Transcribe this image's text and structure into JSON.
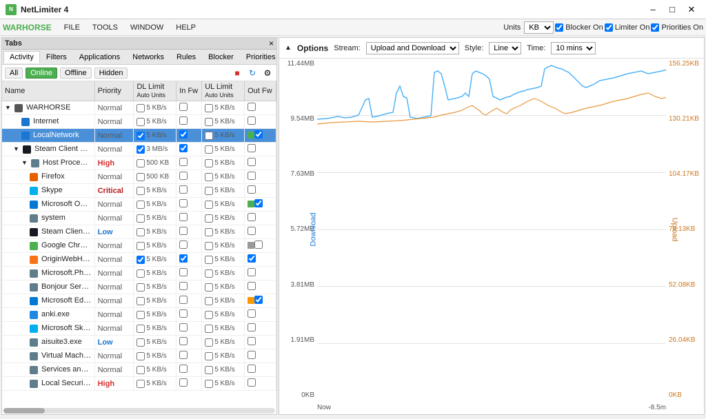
{
  "titleBar": {
    "title": "NetLimiter 4",
    "controls": [
      "minimize",
      "maximize",
      "close"
    ]
  },
  "menuBar": {
    "appName": "WARHORSE",
    "items": [
      "FILE",
      "TOOLS",
      "WINDOW",
      "HELP"
    ],
    "units_label": "Units",
    "units_value": "KB",
    "blocker_on": "Blocker On",
    "limiter_on": "Limiter On",
    "priorities_on": "Priorities On"
  },
  "tabsPanel": {
    "label": "Tabs",
    "close": "×"
  },
  "leftPanel": {
    "tabs": [
      {
        "label": "Activity",
        "active": true
      },
      {
        "label": "Filters",
        "active": false
      },
      {
        "label": "Applications",
        "active": false
      },
      {
        "label": "Networks",
        "active": false
      },
      {
        "label": "Rules",
        "active": false
      },
      {
        "label": "Blocker",
        "active": false
      },
      {
        "label": "Priorities",
        "active": false
      }
    ],
    "filters": [
      {
        "label": "All",
        "active": false
      },
      {
        "label": "Online",
        "active": true
      },
      {
        "label": "Offline",
        "active": false
      },
      {
        "label": "Hidden",
        "active": false
      }
    ],
    "columns": {
      "name": "Name",
      "priority": "Priority",
      "dl_limit": "DL Limit",
      "dl_limit_sub": "Auto Units",
      "in_fw": "In Fw",
      "ul_limit": "UL Limit",
      "ul_limit_sub": "Auto Units",
      "out_fw": "Out Fw"
    },
    "rows": [
      {
        "level": 0,
        "expand": true,
        "icon": "pc",
        "name": "WARHORSE",
        "priority": "Normal",
        "dl_limit": "5 KB/s",
        "in_fw": false,
        "ul_limit": "5 KB/s",
        "out_fw": false,
        "indicator": "none"
      },
      {
        "level": 1,
        "expand": false,
        "icon": "net",
        "name": "Internet",
        "priority": "Normal",
        "dl_limit": "5 KB/s",
        "in_fw": false,
        "ul_limit": "5 KB/s",
        "out_fw": false,
        "indicator": "none"
      },
      {
        "level": 1,
        "expand": false,
        "icon": "net",
        "name": "LocalNetwork",
        "priority": "Normal",
        "dl_limit": "5 KB/s",
        "in_fw": true,
        "ul_limit": "5 KB/s",
        "out_fw": true,
        "indicator": "green",
        "selected": true
      },
      {
        "level": 1,
        "expand": true,
        "icon": "steam",
        "name": "Steam Client Bootstra",
        "priority": "Normal",
        "dl_limit": "3 MB/s",
        "in_fw": true,
        "ul_limit": "5 KB/s",
        "out_fw": false,
        "indicator": "none"
      },
      {
        "level": 2,
        "expand": true,
        "icon": "proc",
        "name": "Host Process for Winc",
        "priority": "High",
        "dl_limit": "500 KB",
        "in_fw": false,
        "ul_limit": "5 KB/s",
        "out_fw": false,
        "indicator": "none"
      },
      {
        "level": 2,
        "expand": false,
        "icon": "firefox",
        "name": "Firefox",
        "priority": "Normal",
        "dl_limit": "500 KB",
        "in_fw": false,
        "ul_limit": "5 KB/s",
        "out_fw": false,
        "indicator": "none"
      },
      {
        "level": 2,
        "expand": false,
        "icon": "skype",
        "name": "Skype",
        "priority": "Critical",
        "dl_limit": "5 KB/s",
        "in_fw": false,
        "ul_limit": "5 KB/s",
        "out_fw": false,
        "indicator": "none"
      },
      {
        "level": 2,
        "expand": false,
        "icon": "onedrive",
        "name": "Microsoft OneDrive",
        "priority": "Normal",
        "dl_limit": "5 KB/s",
        "in_fw": false,
        "ul_limit": "5 KB/s",
        "out_fw": true,
        "indicator": "green"
      },
      {
        "level": 2,
        "expand": false,
        "icon": "proc",
        "name": "system",
        "priority": "Normal",
        "dl_limit": "5 KB/s",
        "in_fw": false,
        "ul_limit": "5 KB/s",
        "out_fw": false,
        "indicator": "none"
      },
      {
        "level": 2,
        "expand": false,
        "icon": "steam",
        "name": "Steam Client WebHel",
        "priority": "Low",
        "dl_limit": "5 KB/s",
        "in_fw": false,
        "ul_limit": "5 KB/s",
        "out_fw": false,
        "indicator": "none"
      },
      {
        "level": 2,
        "expand": false,
        "icon": "chrome",
        "name": "Google Chrome",
        "priority": "Normal",
        "dl_limit": "5 KB/s",
        "in_fw": false,
        "ul_limit": "5 KB/s",
        "out_fw": false,
        "indicator": "grey"
      },
      {
        "level": 2,
        "expand": false,
        "icon": "origin",
        "name": "OriginWebHelperServ",
        "priority": "Normal",
        "dl_limit": "5 KB/s",
        "in_fw": true,
        "ul_limit": "5 KB/s",
        "out_fw": true,
        "indicator": "none"
      },
      {
        "level": 2,
        "expand": false,
        "icon": "proc",
        "name": "Microsoft.Photos.exe",
        "priority": "Normal",
        "dl_limit": "5 KB/s",
        "in_fw": false,
        "ul_limit": "5 KB/s",
        "out_fw": false,
        "indicator": "none"
      },
      {
        "level": 2,
        "expand": false,
        "icon": "proc",
        "name": "Bonjour Service",
        "priority": "Normal",
        "dl_limit": "5 KB/s",
        "in_fw": false,
        "ul_limit": "5 KB/s",
        "out_fw": false,
        "indicator": "none"
      },
      {
        "level": 2,
        "expand": false,
        "icon": "edge",
        "name": "Microsoft Edge",
        "priority": "Normal",
        "dl_limit": "5 KB/s",
        "in_fw": false,
        "ul_limit": "5 KB/s",
        "out_fw": true,
        "indicator": "orange"
      },
      {
        "level": 2,
        "expand": false,
        "icon": "anki",
        "name": "anki.exe",
        "priority": "Normal",
        "dl_limit": "5 KB/s",
        "in_fw": false,
        "ul_limit": "5 KB/s",
        "out_fw": false,
        "indicator": "none"
      },
      {
        "level": 2,
        "expand": false,
        "icon": "skype",
        "name": "Microsoft Skype",
        "priority": "Normal",
        "dl_limit": "5 KB/s",
        "in_fw": false,
        "ul_limit": "5 KB/s",
        "out_fw": false,
        "indicator": "none"
      },
      {
        "level": 2,
        "expand": false,
        "icon": "proc",
        "name": "aisuite3.exe",
        "priority": "Low",
        "dl_limit": "5 KB/s",
        "in_fw": false,
        "ul_limit": "5 KB/s",
        "out_fw": false,
        "indicator": "none"
      },
      {
        "level": 2,
        "expand": false,
        "icon": "proc",
        "name": "Virtual Machine Mana",
        "priority": "Normal",
        "dl_limit": "5 KB/s",
        "in_fw": false,
        "ul_limit": "5 KB/s",
        "out_fw": false,
        "indicator": "none"
      },
      {
        "level": 2,
        "expand": false,
        "icon": "proc",
        "name": "Services and Controlle",
        "priority": "Normal",
        "dl_limit": "5 KB/s",
        "in_fw": false,
        "ul_limit": "5 KB/s",
        "out_fw": false,
        "indicator": "none"
      },
      {
        "level": 2,
        "expand": false,
        "icon": "proc",
        "name": "Local Security Autho",
        "priority": "High",
        "dl_limit": "5 KB/s",
        "in_fw": false,
        "ul_limit": "5 KB/s",
        "out_fw": false,
        "indicator": "none"
      }
    ]
  },
  "rightPanel": {
    "options_label": "Options",
    "stream_label": "Stream:",
    "stream_value": "Upload and Download",
    "style_label": "Style:",
    "style_value": "Line",
    "time_label": "Time:",
    "time_value": "10 mins",
    "y_left": [
      "11.44MB",
      "9.54MB",
      "7.63MB",
      "5.72MB",
      "3.81MB",
      "1.91MB",
      "0KB"
    ],
    "y_right": [
      "156.25KB",
      "130.21KB",
      "104.17KB",
      "78.13KB",
      "52.08KB",
      "26.04KB",
      "0KB"
    ],
    "x_labels": [
      "Now",
      "",
      "",
      " ",
      "",
      " ",
      "",
      " ",
      "-8.5m"
    ],
    "dl_label": "Download",
    "ul_label": "Upload"
  }
}
